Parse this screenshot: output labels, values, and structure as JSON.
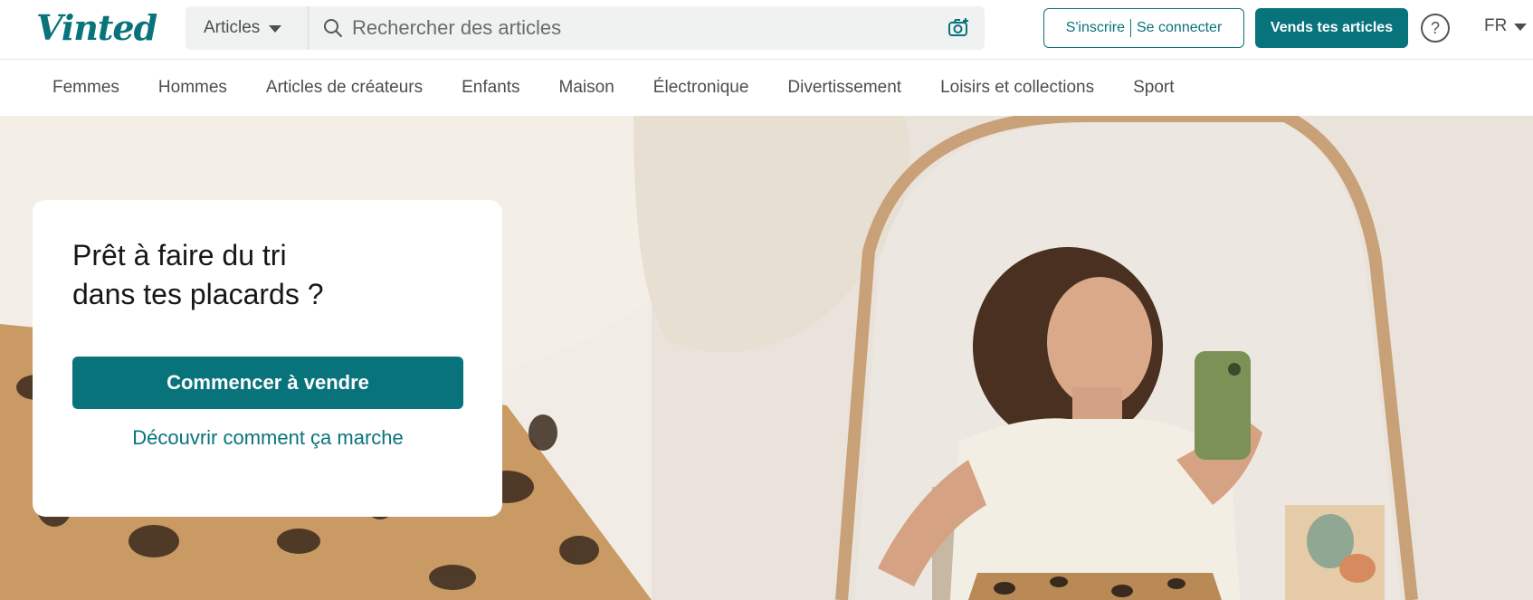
{
  "header": {
    "logo": "Vinted",
    "search": {
      "category": "Articles",
      "placeholder": "Rechercher des articles"
    },
    "auth": {
      "signup": "S'inscrire",
      "login": "Se connecter"
    },
    "sell_button": "Vends tes articles",
    "help_symbol": "?",
    "language": "FR",
    "icons": [
      "search-icon",
      "camera-icon",
      "help-icon",
      "chevron-down-icon"
    ]
  },
  "categories": [
    "Femmes",
    "Hommes",
    "Articles de créateurs",
    "Enfants",
    "Maison",
    "Électronique",
    "Divertissement",
    "Loisirs et collections",
    "Sport"
  ],
  "hero": {
    "title_line1": "Prêt à faire du tri",
    "title_line2": "dans tes placards ?",
    "cta": "Commencer à vendre",
    "link": "Découvrir comment ça marche"
  },
  "colors": {
    "brand": "#09737c",
    "text": "#171717",
    "muted": "#4d4d4d",
    "search_bg": "#eff2f1"
  }
}
